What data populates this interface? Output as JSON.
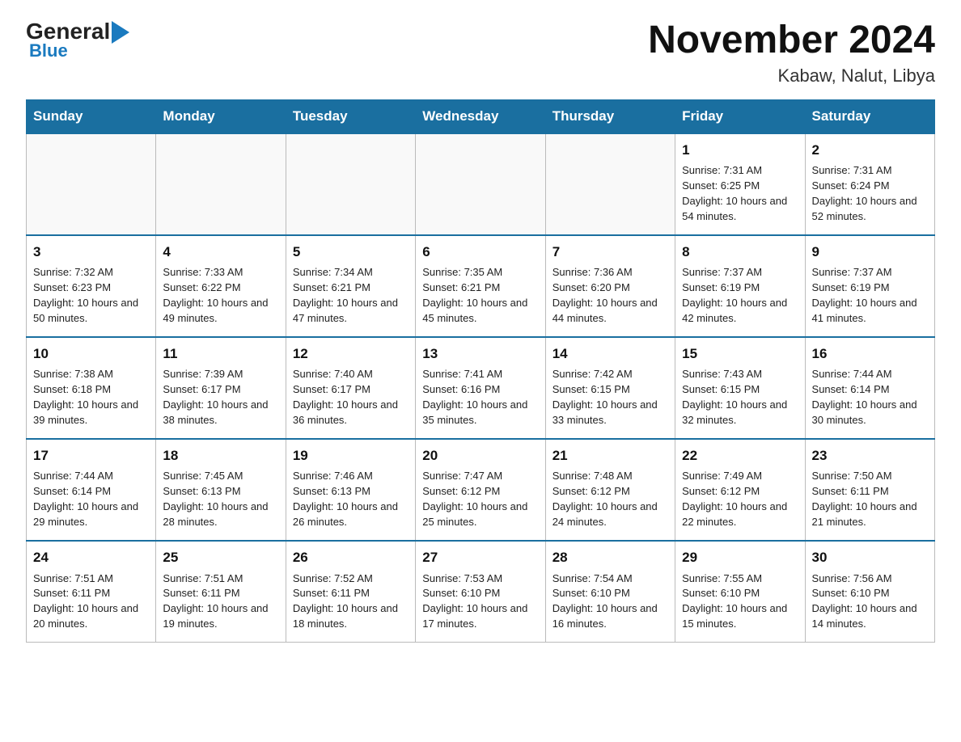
{
  "logo": {
    "general": "General",
    "blue": "Blue",
    "arrow": "▶"
  },
  "title": "November 2024",
  "location": "Kabaw, Nalut, Libya",
  "weekdays": [
    "Sunday",
    "Monday",
    "Tuesday",
    "Wednesday",
    "Thursday",
    "Friday",
    "Saturday"
  ],
  "weeks": [
    [
      {
        "day": "",
        "info": ""
      },
      {
        "day": "",
        "info": ""
      },
      {
        "day": "",
        "info": ""
      },
      {
        "day": "",
        "info": ""
      },
      {
        "day": "",
        "info": ""
      },
      {
        "day": "1",
        "info": "Sunrise: 7:31 AM\nSunset: 6:25 PM\nDaylight: 10 hours and 54 minutes."
      },
      {
        "day": "2",
        "info": "Sunrise: 7:31 AM\nSunset: 6:24 PM\nDaylight: 10 hours and 52 minutes."
      }
    ],
    [
      {
        "day": "3",
        "info": "Sunrise: 7:32 AM\nSunset: 6:23 PM\nDaylight: 10 hours and 50 minutes."
      },
      {
        "day": "4",
        "info": "Sunrise: 7:33 AM\nSunset: 6:22 PM\nDaylight: 10 hours and 49 minutes."
      },
      {
        "day": "5",
        "info": "Sunrise: 7:34 AM\nSunset: 6:21 PM\nDaylight: 10 hours and 47 minutes."
      },
      {
        "day": "6",
        "info": "Sunrise: 7:35 AM\nSunset: 6:21 PM\nDaylight: 10 hours and 45 minutes."
      },
      {
        "day": "7",
        "info": "Sunrise: 7:36 AM\nSunset: 6:20 PM\nDaylight: 10 hours and 44 minutes."
      },
      {
        "day": "8",
        "info": "Sunrise: 7:37 AM\nSunset: 6:19 PM\nDaylight: 10 hours and 42 minutes."
      },
      {
        "day": "9",
        "info": "Sunrise: 7:37 AM\nSunset: 6:19 PM\nDaylight: 10 hours and 41 minutes."
      }
    ],
    [
      {
        "day": "10",
        "info": "Sunrise: 7:38 AM\nSunset: 6:18 PM\nDaylight: 10 hours and 39 minutes."
      },
      {
        "day": "11",
        "info": "Sunrise: 7:39 AM\nSunset: 6:17 PM\nDaylight: 10 hours and 38 minutes."
      },
      {
        "day": "12",
        "info": "Sunrise: 7:40 AM\nSunset: 6:17 PM\nDaylight: 10 hours and 36 minutes."
      },
      {
        "day": "13",
        "info": "Sunrise: 7:41 AM\nSunset: 6:16 PM\nDaylight: 10 hours and 35 minutes."
      },
      {
        "day": "14",
        "info": "Sunrise: 7:42 AM\nSunset: 6:15 PM\nDaylight: 10 hours and 33 minutes."
      },
      {
        "day": "15",
        "info": "Sunrise: 7:43 AM\nSunset: 6:15 PM\nDaylight: 10 hours and 32 minutes."
      },
      {
        "day": "16",
        "info": "Sunrise: 7:44 AM\nSunset: 6:14 PM\nDaylight: 10 hours and 30 minutes."
      }
    ],
    [
      {
        "day": "17",
        "info": "Sunrise: 7:44 AM\nSunset: 6:14 PM\nDaylight: 10 hours and 29 minutes."
      },
      {
        "day": "18",
        "info": "Sunrise: 7:45 AM\nSunset: 6:13 PM\nDaylight: 10 hours and 28 minutes."
      },
      {
        "day": "19",
        "info": "Sunrise: 7:46 AM\nSunset: 6:13 PM\nDaylight: 10 hours and 26 minutes."
      },
      {
        "day": "20",
        "info": "Sunrise: 7:47 AM\nSunset: 6:12 PM\nDaylight: 10 hours and 25 minutes."
      },
      {
        "day": "21",
        "info": "Sunrise: 7:48 AM\nSunset: 6:12 PM\nDaylight: 10 hours and 24 minutes."
      },
      {
        "day": "22",
        "info": "Sunrise: 7:49 AM\nSunset: 6:12 PM\nDaylight: 10 hours and 22 minutes."
      },
      {
        "day": "23",
        "info": "Sunrise: 7:50 AM\nSunset: 6:11 PM\nDaylight: 10 hours and 21 minutes."
      }
    ],
    [
      {
        "day": "24",
        "info": "Sunrise: 7:51 AM\nSunset: 6:11 PM\nDaylight: 10 hours and 20 minutes."
      },
      {
        "day": "25",
        "info": "Sunrise: 7:51 AM\nSunset: 6:11 PM\nDaylight: 10 hours and 19 minutes."
      },
      {
        "day": "26",
        "info": "Sunrise: 7:52 AM\nSunset: 6:11 PM\nDaylight: 10 hours and 18 minutes."
      },
      {
        "day": "27",
        "info": "Sunrise: 7:53 AM\nSunset: 6:10 PM\nDaylight: 10 hours and 17 minutes."
      },
      {
        "day": "28",
        "info": "Sunrise: 7:54 AM\nSunset: 6:10 PM\nDaylight: 10 hours and 16 minutes."
      },
      {
        "day": "29",
        "info": "Sunrise: 7:55 AM\nSunset: 6:10 PM\nDaylight: 10 hours and 15 minutes."
      },
      {
        "day": "30",
        "info": "Sunrise: 7:56 AM\nSunset: 6:10 PM\nDaylight: 10 hours and 14 minutes."
      }
    ]
  ]
}
